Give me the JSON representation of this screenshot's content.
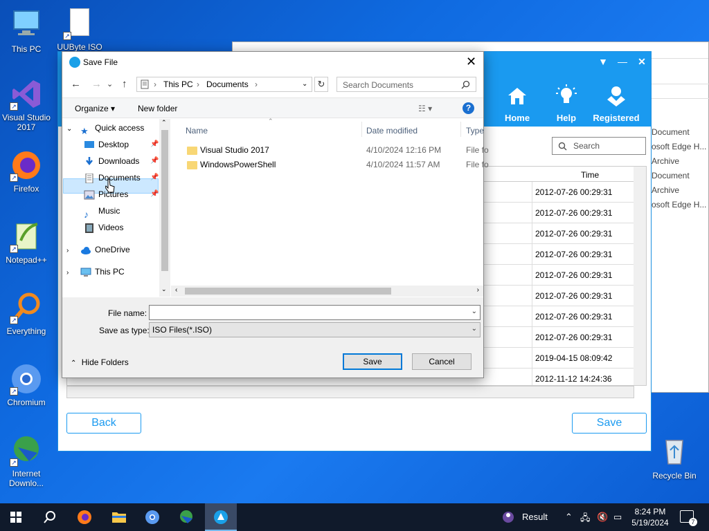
{
  "desktop": {
    "icons": [
      {
        "label": "This PC",
        "icon": "monitor-icon"
      },
      {
        "label": "UUByte ISO",
        "icon": "file-icon"
      },
      {
        "label": "Visual Studio 2017",
        "icon": "visual-studio-icon"
      },
      {
        "label": "Firefox",
        "icon": "firefox-icon"
      },
      {
        "label": "Notepad++",
        "icon": "notepad-plus-plus-icon"
      },
      {
        "label": "Everything",
        "icon": "everything-search-icon"
      },
      {
        "label": "Chromium",
        "icon": "chromium-icon"
      },
      {
        "label": "Internet Downlo...",
        "icon": "internet-download-manager-icon"
      },
      {
        "label": "Recycle Bin",
        "icon": "recycle-bin-icon"
      }
    ]
  },
  "bg_window": {
    "list": [
      "Document",
      "osoft Edge H...",
      "Archive",
      "Document",
      "Archive",
      "osoft Edge H..."
    ]
  },
  "app": {
    "nav": [
      {
        "label": "Home",
        "icon": "home-icon"
      },
      {
        "label": "Help",
        "icon": "lightbulb-icon"
      },
      {
        "label": "Registered",
        "icon": "user-badge-icon"
      }
    ],
    "search_placeholder": "Search",
    "table": {
      "time_header": "Time",
      "rows": [
        "2012-07-26 00:29:31",
        "2012-07-26 00:29:31",
        "2012-07-26 00:29:31",
        "2012-07-26 00:29:31",
        "2012-07-26 00:29:31",
        "2012-07-26 00:29:31",
        "2012-07-26 00:29:31",
        "2012-07-26 00:29:31",
        "2019-04-15 08:09:42",
        "2012-11-12 14:24:36"
      ]
    },
    "back_label": "Back",
    "save_label": "Save"
  },
  "dialog": {
    "title": "Save File",
    "breadcrumb": [
      "This PC",
      "Documents"
    ],
    "search_placeholder": "Search Documents",
    "organize_label": "Organize ▾",
    "new_folder_label": "New folder",
    "help_label": "?",
    "tree": {
      "quick_access": "Quick access",
      "items": [
        {
          "label": "Desktop",
          "icon": "desktop-icon",
          "pinned": true
        },
        {
          "label": "Downloads",
          "icon": "download-icon",
          "pinned": true
        },
        {
          "label": "Documents",
          "icon": "documents-icon",
          "pinned": true,
          "selected": true
        },
        {
          "label": "Pictures",
          "icon": "pictures-icon",
          "pinned": true
        },
        {
          "label": "Music",
          "icon": "music-icon",
          "pinned": false
        },
        {
          "label": "Videos",
          "icon": "videos-icon",
          "pinned": false
        }
      ],
      "onedrive": "OneDrive",
      "this_pc": "This PC"
    },
    "columns": {
      "name": "Name",
      "date": "Date modified",
      "type": "Type"
    },
    "files": [
      {
        "name": "Visual Studio 2017",
        "date": "4/10/2024 12:16 PM",
        "type": "File fo"
      },
      {
        "name": "WindowsPowerShell",
        "date": "4/10/2024 11:57 AM",
        "type": "File fo"
      }
    ],
    "file_name_label": "File name:",
    "file_name_value": "",
    "save_type_label": "Save as type:",
    "save_type_value": "ISO Files(*.ISO)",
    "hide_folders_label": "Hide Folders",
    "save_button": "Save",
    "cancel_button": "Cancel"
  },
  "taskbar": {
    "tray_label": "Result",
    "time": "8:24 PM",
    "date": "5/19/2024",
    "notification_count": "7"
  }
}
